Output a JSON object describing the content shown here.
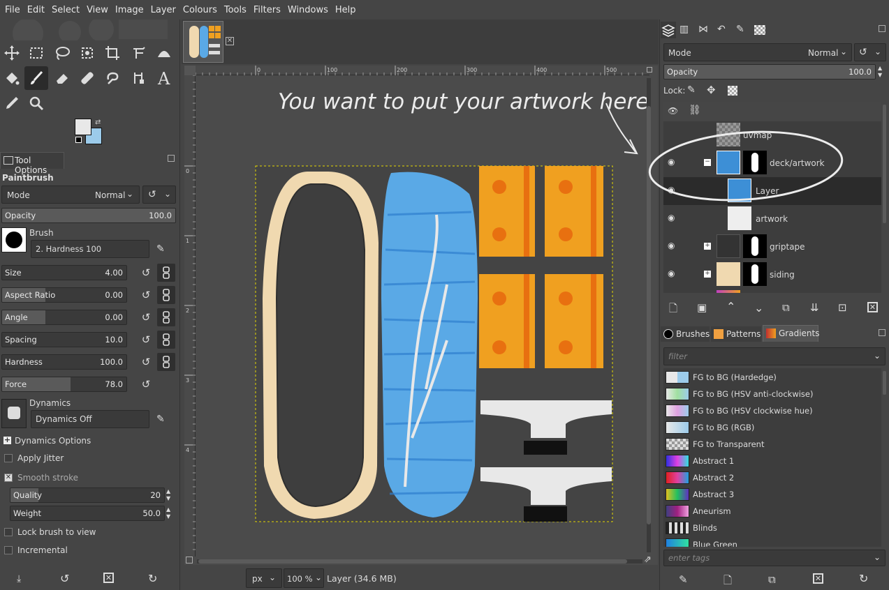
{
  "menu": [
    "File",
    "Edit",
    "Select",
    "View",
    "Image",
    "Layer",
    "Colours",
    "Tools",
    "Filters",
    "Windows",
    "Help"
  ],
  "tool_options": {
    "tab_label": "Tool Options",
    "tool_name": "Paintbrush",
    "mode_label": "Mode",
    "mode_value": "Normal",
    "opacity_label": "Opacity",
    "opacity_value": "100.0",
    "brush_label": "Brush",
    "brush_value": "2. Hardness 100",
    "sliders": [
      {
        "label": "Size",
        "value": "4.00"
      },
      {
        "label": "Aspect Ratio",
        "value": "0.00"
      },
      {
        "label": "Angle",
        "value": "0.00"
      },
      {
        "label": "Spacing",
        "value": "10.0"
      },
      {
        "label": "Hardness",
        "value": "100.0"
      },
      {
        "label": "Force",
        "value": "78.0"
      }
    ],
    "dynamics_label": "Dynamics",
    "dynamics_value": "Dynamics Off",
    "dynamics_options": "Dynamics Options",
    "apply_jitter": "Apply Jitter",
    "smooth_stroke": "Smooth stroke",
    "quality_label": "Quality",
    "quality_value": "20",
    "weight_label": "Weight",
    "weight_value": "50.0",
    "lock_brush": "Lock brush to view",
    "incremental": "Incremental"
  },
  "ruler": {
    "h_ticks": [
      "0",
      "100",
      "200",
      "300",
      "400",
      "500"
    ],
    "v_ticks": [
      "0",
      "1",
      "2",
      "3",
      "4"
    ]
  },
  "annotation": "You want to put your artwork here",
  "status": {
    "unit": "px",
    "zoom": "100 %",
    "layer_info": "Layer (34.6 MB)"
  },
  "layers": {
    "mode_label": "Mode",
    "mode_value": "Normal",
    "opacity_label": "Opacity",
    "opacity_value": "100.0",
    "lock_label": "Lock:",
    "items": [
      {
        "name": "uvmap"
      },
      {
        "name": "deck/artwork"
      },
      {
        "name": "Layer"
      },
      {
        "name": "artwork"
      },
      {
        "name": "griptape"
      },
      {
        "name": "siding"
      }
    ]
  },
  "resources": {
    "tabs": [
      "Brushes",
      "Patterns",
      "Gradients"
    ],
    "filter_placeholder": "filter",
    "tags_placeholder": "enter tags",
    "gradients": [
      {
        "name": "FG to BG (Hardedge)"
      },
      {
        "name": "FG to BG (HSV anti-clockwise)"
      },
      {
        "name": "FG to BG (HSV clockwise hue)"
      },
      {
        "name": "FG to BG (RGB)"
      },
      {
        "name": "FG to Transparent"
      },
      {
        "name": "Abstract 1"
      },
      {
        "name": "Abstract 2"
      },
      {
        "name": "Abstract 3"
      },
      {
        "name": "Aneurism"
      },
      {
        "name": "Blinds"
      },
      {
        "name": "Blue Green"
      }
    ]
  },
  "colors": {
    "fg": "#e8e8e8",
    "bg": "#9ccbea",
    "accent_blue": "#3d8fd6",
    "orange": "#f0a020"
  }
}
